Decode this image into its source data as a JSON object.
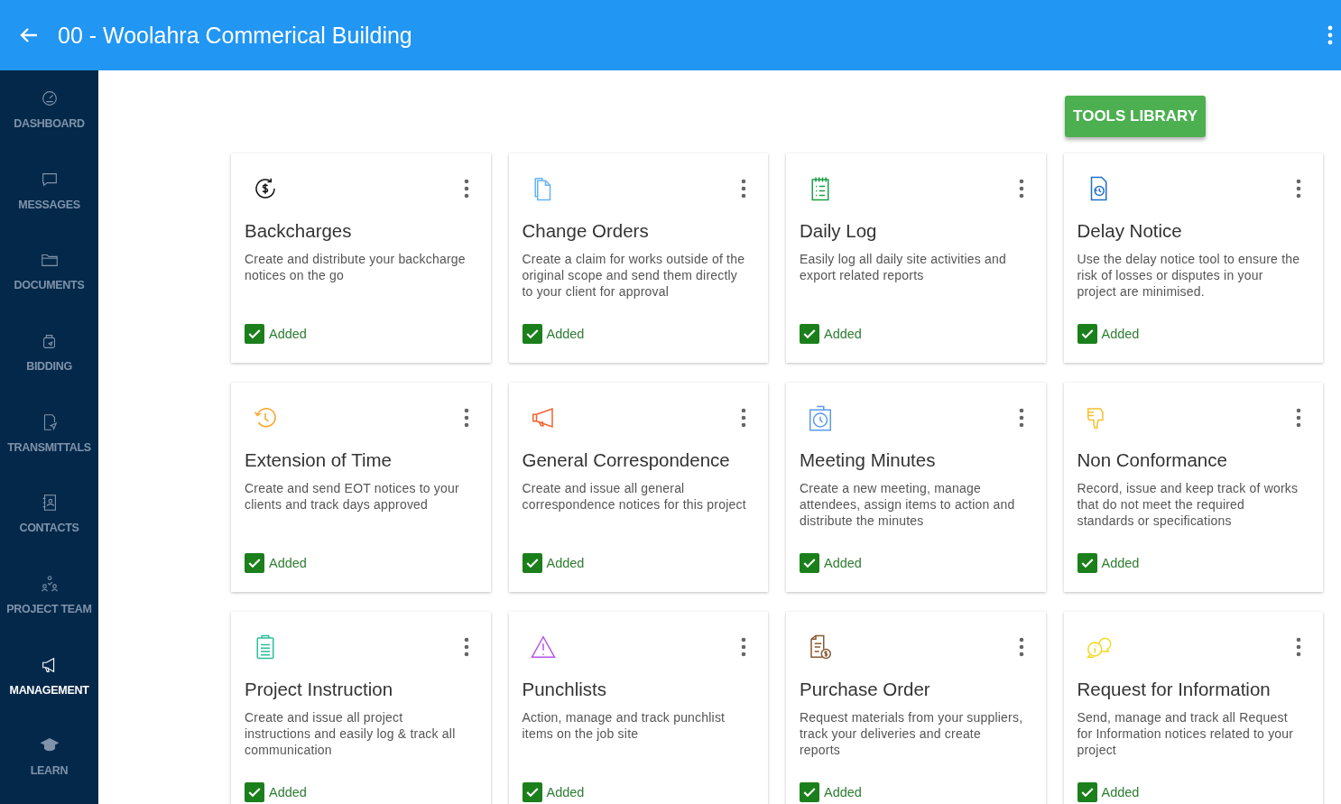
{
  "header": {
    "title": "00 - Woolahra Commerical Building"
  },
  "sidebar": {
    "items": [
      {
        "label": "DASHBOARD",
        "kind": "gauge",
        "selected": false
      },
      {
        "label": "MESSAGES",
        "kind": "chat",
        "selected": false
      },
      {
        "label": "DOCUMENTS",
        "kind": "folder",
        "selected": false
      },
      {
        "label": "BIDDING",
        "kind": "bag",
        "selected": false
      },
      {
        "label": "TRANSMITTALS",
        "kind": "send",
        "selected": false
      },
      {
        "label": "CONTACTS",
        "kind": "book",
        "selected": false
      },
      {
        "label": "PROJECT TEAM",
        "kind": "team",
        "selected": false
      },
      {
        "label": "MANAGEMENT",
        "kind": "megaphone",
        "selected": true
      },
      {
        "label": "LEARN",
        "kind": "cap",
        "selected": false
      }
    ]
  },
  "tools_button": "TOOLS LIBRARY",
  "tools": [
    {
      "title": "Backcharges",
      "description": "Create and distribute your backcharge notices on the go",
      "kind": "dollar",
      "color": "#111111",
      "added": true,
      "status": "Added"
    },
    {
      "title": "Change Orders",
      "description": "Create a claim for works outside of the original scope and send them directly to your client for approval",
      "kind": "docs",
      "color": "#64b5f6",
      "added": true,
      "status": "Added"
    },
    {
      "title": "Daily Log",
      "description": "Easily log all daily site activities and export related reports",
      "kind": "notepad",
      "color": "#1e9e4a",
      "added": true,
      "status": "Added"
    },
    {
      "title": "Delay Notice",
      "description": "Use the delay notice tool to ensure the risk of losses or disputes in your project are minimised.",
      "kind": "docclock",
      "color": "#1f6fcf",
      "added": true,
      "status": "Added"
    },
    {
      "title": "Extension of Time",
      "description": "Create and send EOT notices to your clients and track days approved",
      "kind": "history",
      "color": "#f5a623",
      "added": true,
      "status": "Added"
    },
    {
      "title": "General Correspondence",
      "description": "Create and issue all general correspondence notices for this project",
      "kind": "megaphone",
      "color": "#f4622a",
      "added": true,
      "status": "Added"
    },
    {
      "title": "Meeting Minutes",
      "description": "Create a new meeting, manage attendees, assign items to action and distribute the minutes",
      "kind": "stopwatch",
      "color": "#5b9bea",
      "added": true,
      "status": "Added"
    },
    {
      "title": "Non Conformance",
      "description": "Record, issue and keep track of works that do not meet the required standards or specifications",
      "kind": "thumbdown",
      "color": "#f2c12e",
      "added": true,
      "status": "Added"
    },
    {
      "title": "Project Instruction",
      "description": "Create and issue all project instructions and easily log & track all communication",
      "kind": "clipboard",
      "color": "#2bbf9b",
      "added": true,
      "status": "Added"
    },
    {
      "title": "Punchlists",
      "description": "Action, manage and track punchlist items on the job site",
      "kind": "warning",
      "color": "#b455e8",
      "added": true,
      "status": "Added"
    },
    {
      "title": "Purchase Order",
      "description": "Request materials from your suppliers, track your deliveries and create reports",
      "kind": "invoice",
      "color": "#8a5a32",
      "added": true,
      "status": "Added"
    },
    {
      "title": "Request for Information",
      "description": "Send, manage and track all Request for Information notices related to your project",
      "kind": "infochat",
      "color": "#f3d81c",
      "added": true,
      "status": "Added"
    }
  ]
}
